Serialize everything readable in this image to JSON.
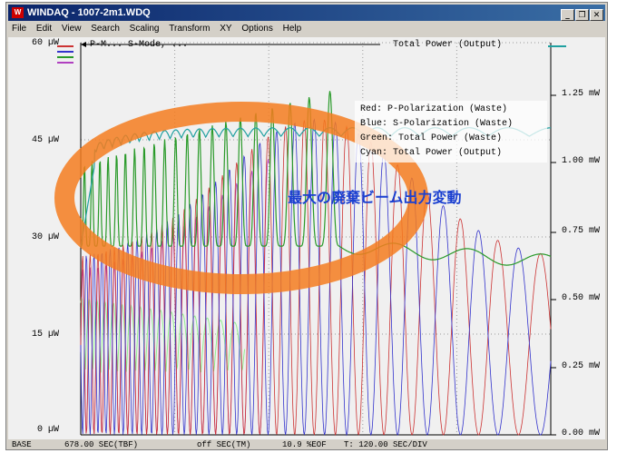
{
  "window": {
    "title": "WINDAQ - 1007-2m1.WDQ",
    "app_icon": "windaq-app-icon",
    "controls": [
      "_",
      "1",
      "×"
    ]
  },
  "menu": [
    {
      "label": "File"
    },
    {
      "label": "Edit"
    },
    {
      "label": "View"
    },
    {
      "label": "Search"
    },
    {
      "label": "Scaling"
    },
    {
      "label": "Transform"
    },
    {
      "label": "XY"
    },
    {
      "label": "Options"
    },
    {
      "label": "Help"
    }
  ],
  "plot": {
    "header_left": "P-M... S-Mode, ...",
    "header_right": "Total Power (Output)",
    "left_axis_ticks": [
      "60 µW",
      "45 µW",
      "30 µW",
      "15 µW",
      "0 µW"
    ],
    "right_axis_ticks": [
      "1.25 mW",
      "1.00 mW",
      "0.75 mW",
      "0.50 mW",
      "0.25 mW",
      "0.00 mW"
    ],
    "legend": [
      "Red: P-Polarization (Waste)",
      "Blue: S-Polarization (Waste)",
      "Green: Total Power (Waste)",
      "Cyan: Total Power (Output)"
    ],
    "annotation": "最大の廃棄ビーム出力変動",
    "colors": {
      "red": "#cc3333",
      "blue": "#3333cc",
      "magenta": "#b040c0",
      "green": "#2a9a2a",
      "light_green": "#90ee90",
      "cyan": "#20a0a0",
      "highlight": "#f47c20",
      "annotation": "#1a3fd0"
    }
  },
  "status": {
    "base": "BASE",
    "time": "678.00 SEC(TBF)",
    "off": "off SEC(TM)",
    "eof": "10.9 %EOF",
    "div": "T: 120.00 SEC/DIV"
  }
}
